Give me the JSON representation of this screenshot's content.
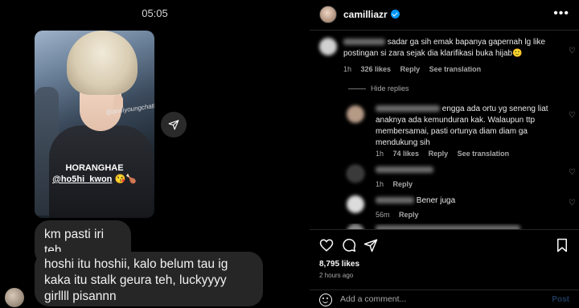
{
  "chat": {
    "time": "05:05",
    "story": {
      "watermark": "@anniyoungchatlo",
      "caption_line1": "HORANGHAE",
      "caption_handle": "@ho5hi_kwon",
      "caption_emoji": "😘🍗"
    },
    "messages": [
      {
        "text": "km pasti iri teh"
      },
      {
        "text": "hoshi itu hoshii, kalo belum tau ig kaka itu stalk geura teh, luckyyyy girllll pisannn"
      }
    ]
  },
  "post": {
    "username": "camilliazr",
    "more_icon": "more-horizontal-icon",
    "comments": [
      {
        "text": "sadar ga sih emak bapanya gapernah lg like postingan si zara sejak dia klarifikasi buka hijab🙂",
        "time": "1h",
        "likes": "326 likes",
        "reply": "Reply",
        "translation": "See translation"
      },
      {
        "hide_replies": "Hide replies"
      },
      {
        "text": "engga ada ortu yg seneng liat anaknya ada kemunduran kak. Walaupun ttp membersamai, pasti ortunya diam diam ga mendukung sih",
        "time": "1h",
        "likes": "74 likes",
        "reply": "Reply",
        "translation": "See translation"
      },
      {
        "text": "",
        "time": "1h",
        "reply": "Reply"
      },
      {
        "text": "Bener juga",
        "time": "56m",
        "reply": "Reply"
      }
    ],
    "likes_count": "8,795 likes",
    "posted_ago": "2 hours ago",
    "add_comment_placeholder": "Add a comment...",
    "post_label": "Post",
    "accent_color": "#0095f6"
  }
}
